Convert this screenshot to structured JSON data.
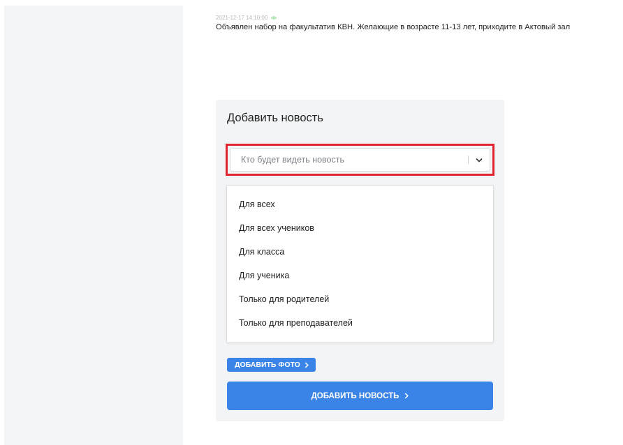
{
  "news": {
    "timestamp": "2021-12-17 14:10:00",
    "text": "Объявлен набор на факультатив КВН. Желающие в возрасте 11-13 лет, приходите в Актовый зал"
  },
  "form": {
    "title": "Добавить новость",
    "audience_select": {
      "placeholder": "Кто будет видеть новость",
      "options": [
        "Для всех",
        "Для всех учеников",
        "Для класса",
        "Для ученика",
        "Только для родителей",
        "Только для преподавателей"
      ]
    },
    "add_photo_label": "ДОБАВИТЬ ФОТО",
    "submit_label": "ДОБАВИТЬ НОВОСТЬ"
  },
  "icons": {
    "eye": "eye-icon",
    "chevron_down": "chevron-down-icon",
    "chevron_right": "chevron-right-icon"
  },
  "colors": {
    "accent": "#3a84e8",
    "highlight": "#e32230",
    "eye": "#7dd87d"
  }
}
